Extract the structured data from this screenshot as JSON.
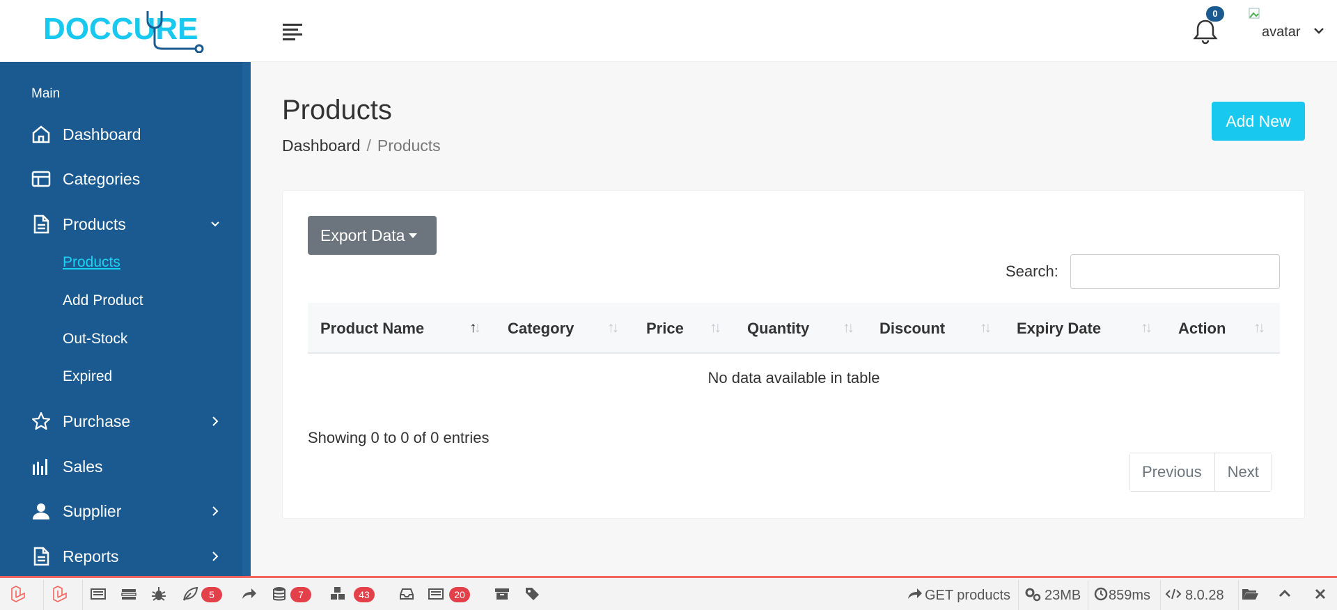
{
  "header": {
    "logo_text": "DOCCURE",
    "notification_count": "0",
    "user_label": "avatar"
  },
  "sidebar": {
    "section_title": "Main",
    "items": [
      {
        "label": "Dashboard",
        "icon": "home-icon"
      },
      {
        "label": "Categories",
        "icon": "layout-icon"
      },
      {
        "label": "Products",
        "icon": "document-icon",
        "expanded": true
      },
      {
        "label": "Purchase",
        "icon": "star-icon"
      },
      {
        "label": "Sales",
        "icon": "bar-chart-icon"
      },
      {
        "label": "Supplier",
        "icon": "user-icon"
      },
      {
        "label": "Reports",
        "icon": "document-icon"
      }
    ],
    "products_submenu": [
      {
        "label": "Products",
        "active": true
      },
      {
        "label": "Add Product"
      },
      {
        "label": "Out-Stock"
      },
      {
        "label": "Expired"
      }
    ]
  },
  "page": {
    "title": "Products",
    "breadcrumb": [
      "Dashboard",
      "Products"
    ],
    "add_button": "Add New"
  },
  "table": {
    "export_button": "Export Data",
    "search_label": "Search:",
    "search_value": "",
    "columns": [
      "Product Name",
      "Category",
      "Price",
      "Quantity",
      "Discount",
      "Expiry Date",
      "Action"
    ],
    "empty_message": "No data available in table",
    "info": "Showing 0 to 0 of 0 entries",
    "pagination": {
      "previous": "Previous",
      "next": "Next"
    }
  },
  "debugbar": {
    "accent_color": "#f4645f",
    "badges": {
      "exceptions": "5",
      "queries": "7",
      "models": "43",
      "views": "20"
    },
    "route": "GET products",
    "memory": "23MB",
    "time": "859ms",
    "php_version": "8.0.28"
  },
  "colors": {
    "sidebar": "#1b5a90",
    "accent": "#19c8ef",
    "active_link": "#19d3f2",
    "export_button": "#6c757d",
    "badge": "#e3404a"
  }
}
